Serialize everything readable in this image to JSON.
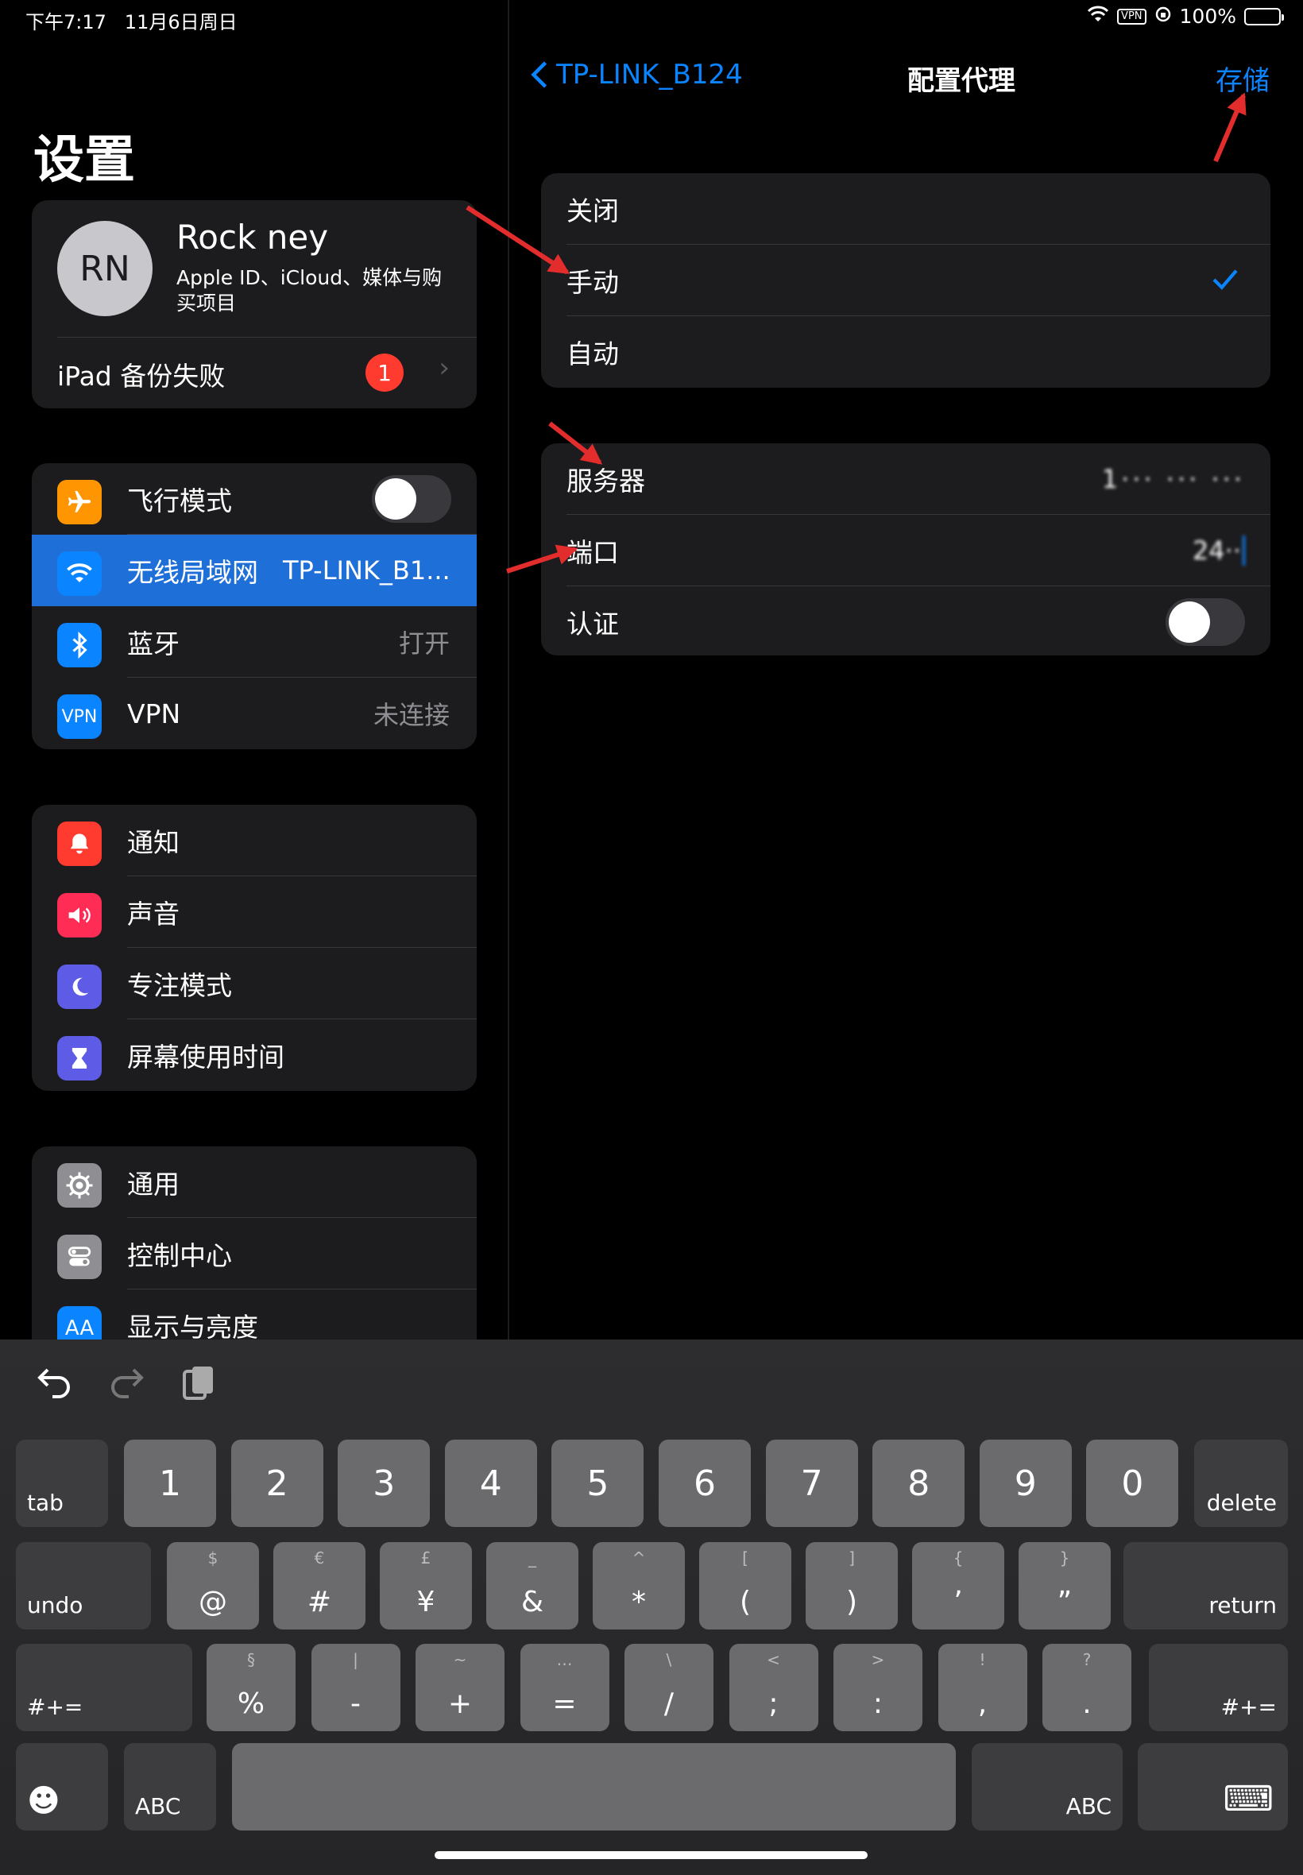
{
  "status": {
    "time": "下午7:17",
    "date": "11月6日周日",
    "vpn": "VPN",
    "battery": "100%"
  },
  "left": {
    "title": "设置",
    "profile": {
      "initials": "RN",
      "name": "Rock ney",
      "subtitle": "Apple ID、iCloud、媒体与购买项目"
    },
    "backup": {
      "label": "iPad 备份失败",
      "badge": "1"
    },
    "connectivity": [
      {
        "label": "飞行模式",
        "icon": "airplane-icon",
        "color": "#ff9500"
      },
      {
        "label": "无线局域网",
        "value": "TP-LINK_B1...",
        "icon": "wifi-icon",
        "color": "#0a84ff"
      },
      {
        "label": "蓝牙",
        "value": "打开",
        "icon": "bluetooth-icon",
        "color": "#0a84ff"
      },
      {
        "label": "VPN",
        "value": "未连接",
        "icon": "vpn-icon",
        "icon_text": "VPN",
        "color": "#0a84ff"
      }
    ],
    "notifications": [
      {
        "label": "通知",
        "icon": "bell-icon",
        "color": "#ff3b30"
      },
      {
        "label": "声音",
        "icon": "speaker-icon",
        "color": "#ff2d55"
      },
      {
        "label": "专注模式",
        "icon": "moon-icon",
        "color": "#5e5ce6"
      },
      {
        "label": "屏幕使用时间",
        "icon": "hourglass-icon",
        "color": "#5e5ce6"
      }
    ],
    "general": [
      {
        "label": "通用",
        "icon": "gear-icon",
        "color": "#8e8e93"
      },
      {
        "label": "控制中心",
        "icon": "toggles-icon",
        "color": "#8e8e93"
      },
      {
        "label": "显示与亮度",
        "icon": "text-size-icon",
        "icon_text": "AA",
        "color": "#0a84ff"
      }
    ]
  },
  "right": {
    "back_label": "TP-LINK_B124",
    "title": "配置代理",
    "save_label": "存储",
    "modes": [
      "关闭",
      "手动",
      "自动"
    ],
    "selected_mode": "手动",
    "fields": {
      "server_label": "服务器",
      "server_value": "1··· ··· ···",
      "port_label": "端口",
      "port_value": "24··",
      "auth_label": "认证"
    }
  },
  "keyboard": {
    "row1": {
      "tab": "tab",
      "keys": [
        "1",
        "2",
        "3",
        "4",
        "5",
        "6",
        "7",
        "8",
        "9",
        "0"
      ],
      "delete": "delete"
    },
    "row2": {
      "undo": "undo",
      "keys": [
        [
          "$",
          "@"
        ],
        [
          "€",
          "#"
        ],
        [
          "£",
          "¥"
        ],
        [
          "_",
          "&"
        ],
        [
          "^",
          "*"
        ],
        [
          "[",
          "("
        ],
        [
          "]",
          ")"
        ],
        [
          "{",
          "’"
        ],
        [
          "}",
          "”"
        ]
      ],
      "return": "return"
    },
    "row3": {
      "shift_left": "#+=",
      "keys": [
        [
          "§",
          "%"
        ],
        [
          "|",
          "-"
        ],
        [
          "~",
          "+"
        ],
        [
          "…",
          "="
        ],
        [
          "\\",
          "/"
        ],
        [
          "<",
          ";"
        ],
        [
          ">",
          ":"
        ],
        [
          "!",
          ","
        ],
        [
          "?",
          "."
        ]
      ],
      "shift_right": "#+="
    },
    "row4": {
      "emoji": "☻",
      "abc_left": "ABC",
      "abc_right": "ABC",
      "hide": "⌨"
    }
  }
}
